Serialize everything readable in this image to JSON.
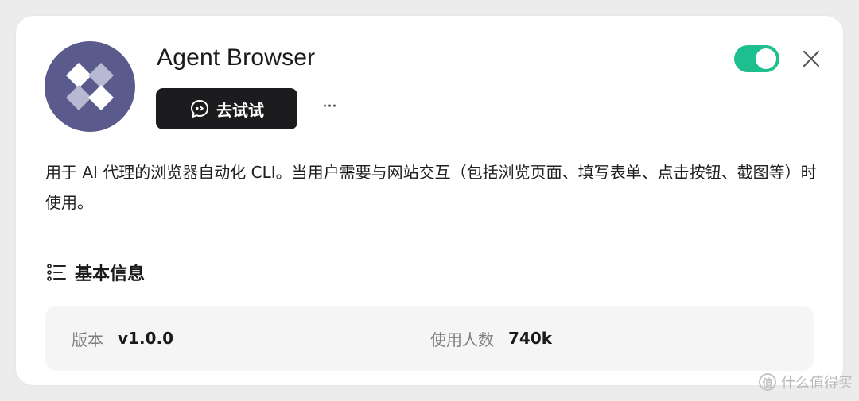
{
  "app": {
    "title": "Agent Browser",
    "enabled": true,
    "accent_color": "#1dbf8e",
    "logo_bg_color": "#5b5a8c",
    "logo_icon": "diamond-cluster-icon"
  },
  "actions": {
    "try_label": "去试试",
    "try_icon": "chat-bubble-icon",
    "more_label": "···",
    "close_icon": "close-icon"
  },
  "description": "用于 AI 代理的浏览器自动化 CLI。当用户需要与网站交互（包括浏览页面、填写表单、点击按钮、截图等）时使用。",
  "basic_info": {
    "title": "基本信息",
    "icon": "list-icon",
    "version_label": "版本",
    "version_value": "v1.0.0",
    "users_label": "使用人数",
    "users_value": "740k"
  },
  "watermark": {
    "badge": "值",
    "text": "什么值得买"
  }
}
